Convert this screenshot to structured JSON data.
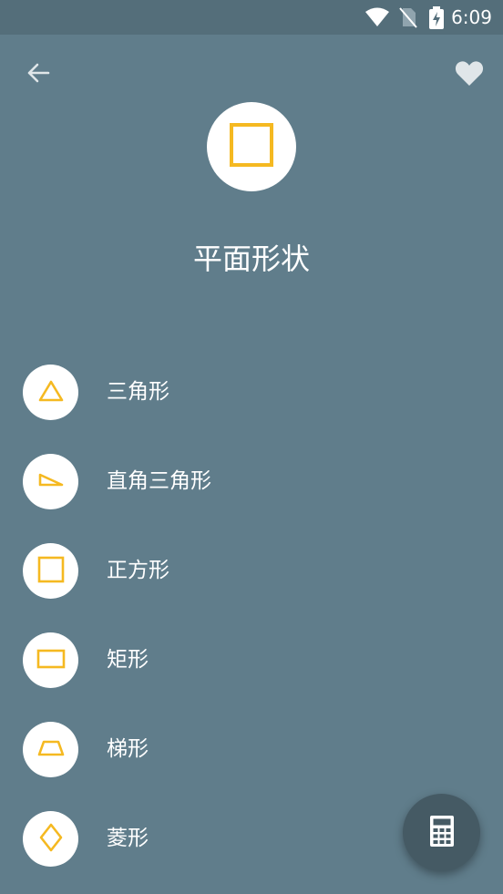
{
  "status_bar": {
    "time": "6:09",
    "icons": [
      "wifi-icon",
      "no-sim-icon",
      "battery-charging-icon"
    ]
  },
  "toolbar": {
    "back_icon": "arrow-left-icon",
    "favorite_icon": "heart-icon"
  },
  "header": {
    "icon": "square-icon",
    "title": "平面形状"
  },
  "shapes": [
    {
      "label": "三角形",
      "icon": "triangle-icon"
    },
    {
      "label": "直角三角形",
      "icon": "right-triangle-icon"
    },
    {
      "label": "正方形",
      "icon": "square-icon"
    },
    {
      "label": "矩形",
      "icon": "rectangle-icon"
    },
    {
      "label": "梯形",
      "icon": "trapezoid-icon"
    },
    {
      "label": "菱形",
      "icon": "rhombus-icon"
    }
  ],
  "fab": {
    "icon": "calculator-icon"
  },
  "colors": {
    "background": "#607d8b",
    "status_bar": "#546e7a",
    "accent": "#f5b921",
    "fab": "#455a64",
    "icon_light": "#e0e6e9"
  }
}
